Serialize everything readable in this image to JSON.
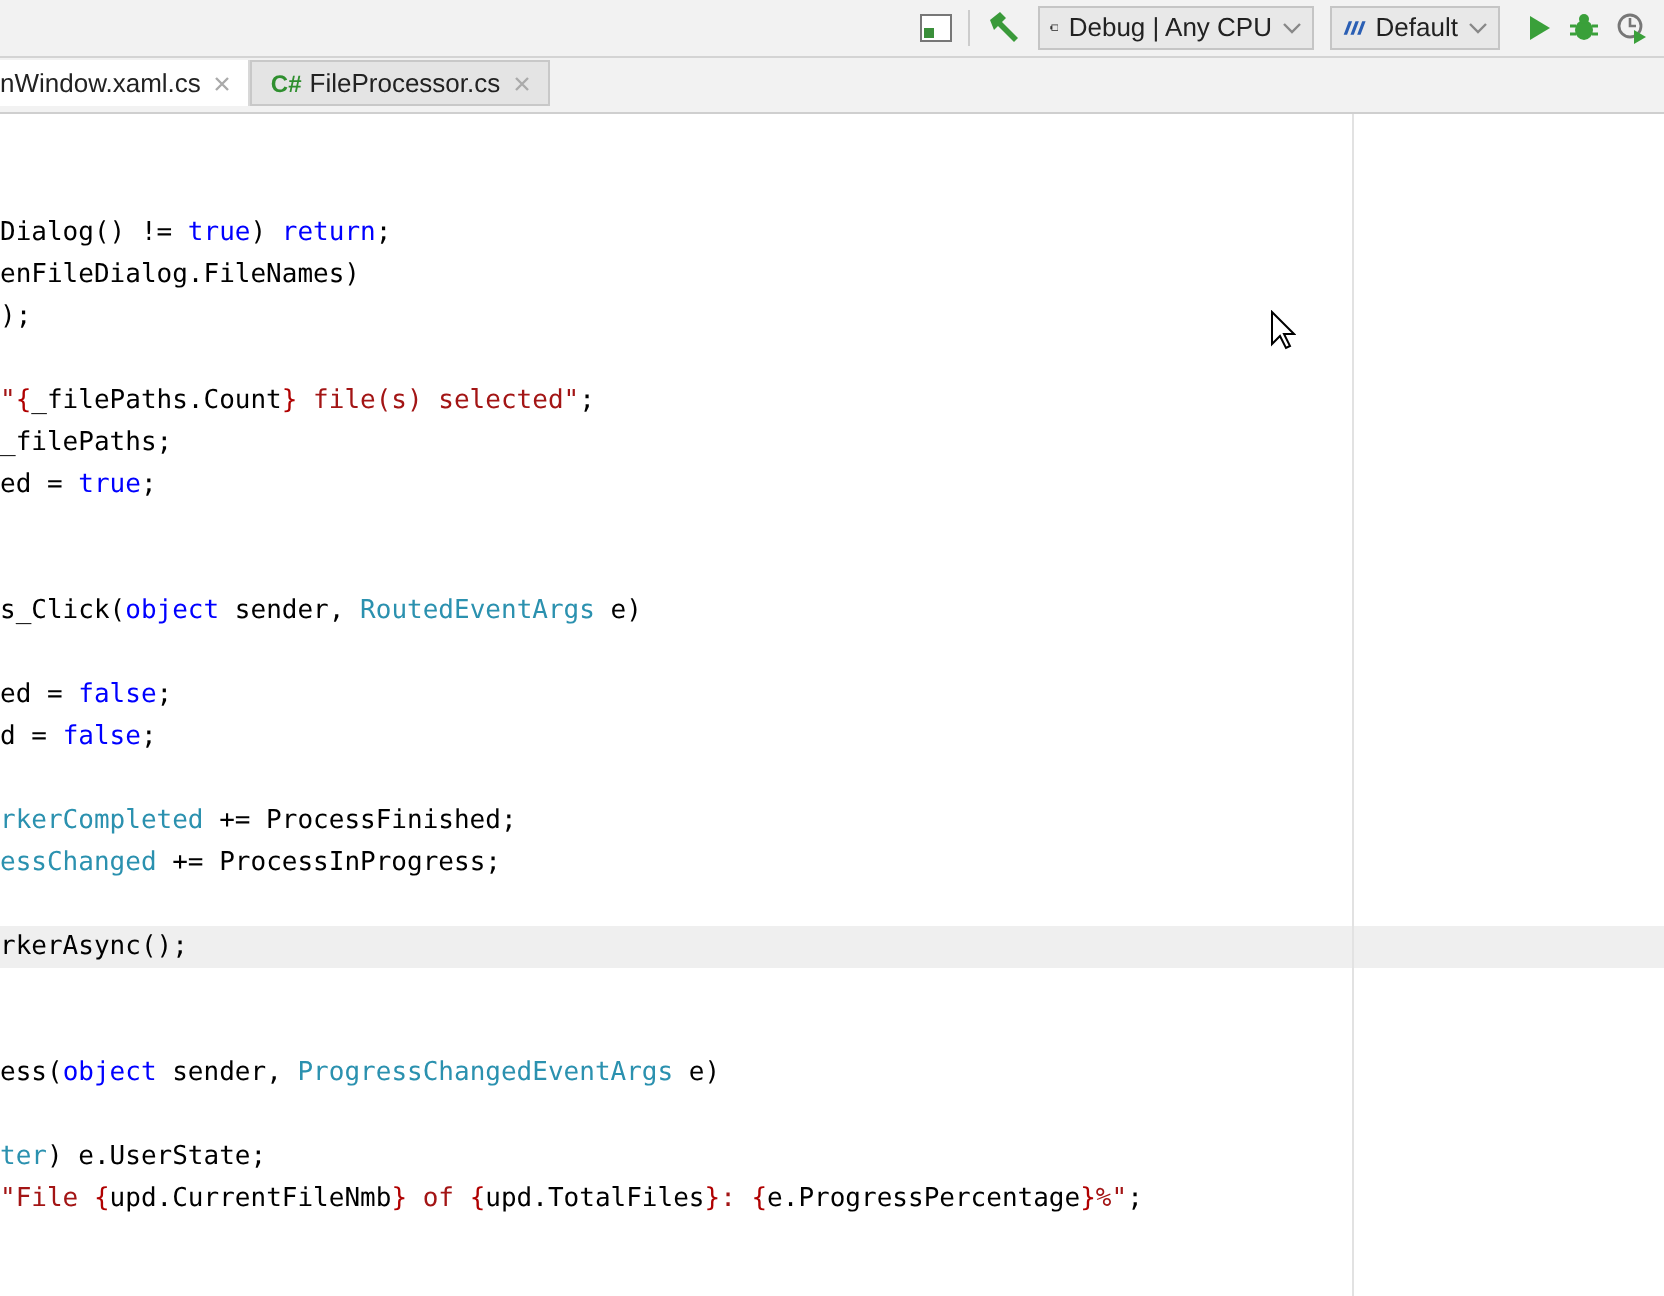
{
  "toolbar": {
    "configuration": "Debug | Any CPU",
    "target": "Default"
  },
  "tabs": [
    {
      "label": "nWindow.xaml.cs",
      "selected": false
    },
    {
      "label": "FileProcessor.cs",
      "selected": true,
      "icon_text": "C#"
    }
  ],
  "editor": {
    "lines": [
      {
        "current": false
      },
      {
        "current": false
      },
      {
        "current": false,
        "tokens": [
          {
            "kind": "plain",
            "text": "Dialog() != "
          },
          {
            "kind": "keyword",
            "text": "true"
          },
          {
            "kind": "plain",
            "text": ") "
          },
          {
            "kind": "keyword",
            "text": "return"
          },
          {
            "kind": "plain",
            "text": ";"
          }
        ]
      },
      {
        "current": false,
        "tokens": [
          {
            "kind": "plain",
            "text": "enFileDialog.FileNames)"
          }
        ]
      },
      {
        "current": false,
        "tokens": [
          {
            "kind": "plain",
            "text": ");"
          }
        ]
      },
      {
        "current": false
      },
      {
        "current": false,
        "tokens": [
          {
            "kind": "string",
            "text": "\""
          },
          {
            "kind": "brace",
            "text": "{"
          },
          {
            "kind": "plain",
            "text": "_filePaths.Count"
          },
          {
            "kind": "brace",
            "text": "}"
          },
          {
            "kind": "string",
            "text": " file(s) selected\""
          },
          {
            "kind": "plain",
            "text": ";"
          }
        ]
      },
      {
        "current": false,
        "tokens": [
          {
            "kind": "plain",
            "text": "_filePaths;"
          }
        ]
      },
      {
        "current": false,
        "tokens": [
          {
            "kind": "plain",
            "text": "ed = "
          },
          {
            "kind": "keyword",
            "text": "true"
          },
          {
            "kind": "plain",
            "text": ";"
          }
        ]
      },
      {
        "current": false
      },
      {
        "current": false
      },
      {
        "current": false,
        "tokens": [
          {
            "kind": "plain",
            "text": "s_Click("
          },
          {
            "kind": "keyword",
            "text": "object"
          },
          {
            "kind": "plain",
            "text": " sender, "
          },
          {
            "kind": "type",
            "text": "RoutedEventArgs"
          },
          {
            "kind": "plain",
            "text": " e)"
          }
        ]
      },
      {
        "current": false
      },
      {
        "current": false,
        "tokens": [
          {
            "kind": "plain",
            "text": "ed = "
          },
          {
            "kind": "keyword",
            "text": "false"
          },
          {
            "kind": "plain",
            "text": ";"
          }
        ]
      },
      {
        "current": false,
        "tokens": [
          {
            "kind": "plain",
            "text": "d = "
          },
          {
            "kind": "keyword",
            "text": "false"
          },
          {
            "kind": "plain",
            "text": ";"
          }
        ]
      },
      {
        "current": false
      },
      {
        "current": false,
        "tokens": [
          {
            "kind": "type",
            "text": "rkerCompleted"
          },
          {
            "kind": "plain",
            "text": " += ProcessFinished;"
          }
        ]
      },
      {
        "current": false,
        "tokens": [
          {
            "kind": "type",
            "text": "essChanged"
          },
          {
            "kind": "plain",
            "text": " += ProcessInProgress;"
          }
        ]
      },
      {
        "current": false
      },
      {
        "current": true,
        "tokens": [
          {
            "kind": "plain",
            "text": "rkerAsync();"
          }
        ]
      },
      {
        "current": false
      },
      {
        "current": false
      },
      {
        "current": false,
        "tokens": [
          {
            "kind": "plain",
            "text": "ess("
          },
          {
            "kind": "keyword",
            "text": "object"
          },
          {
            "kind": "plain",
            "text": " sender, "
          },
          {
            "kind": "type",
            "text": "ProgressChangedEventArgs"
          },
          {
            "kind": "plain",
            "text": " e)"
          }
        ]
      },
      {
        "current": false
      },
      {
        "current": false,
        "tokens": [
          {
            "kind": "type",
            "text": "ter"
          },
          {
            "kind": "plain",
            "text": ") e.UserState;"
          }
        ]
      },
      {
        "current": false,
        "tokens": [
          {
            "kind": "string",
            "text": "\"File "
          },
          {
            "kind": "brace",
            "text": "{"
          },
          {
            "kind": "plain",
            "text": "upd.CurrentFileNmb"
          },
          {
            "kind": "brace",
            "text": "}"
          },
          {
            "kind": "string",
            "text": " of "
          },
          {
            "kind": "brace",
            "text": "{"
          },
          {
            "kind": "plain",
            "text": "upd.TotalFiles"
          },
          {
            "kind": "brace",
            "text": "}"
          },
          {
            "kind": "string",
            "text": ": "
          },
          {
            "kind": "brace",
            "text": "{"
          },
          {
            "kind": "plain",
            "text": "e.ProgressPercentage"
          },
          {
            "kind": "brace",
            "text": "}"
          },
          {
            "kind": "string",
            "text": "%\""
          },
          {
            "kind": "plain",
            "text": ";"
          }
        ]
      }
    ]
  }
}
